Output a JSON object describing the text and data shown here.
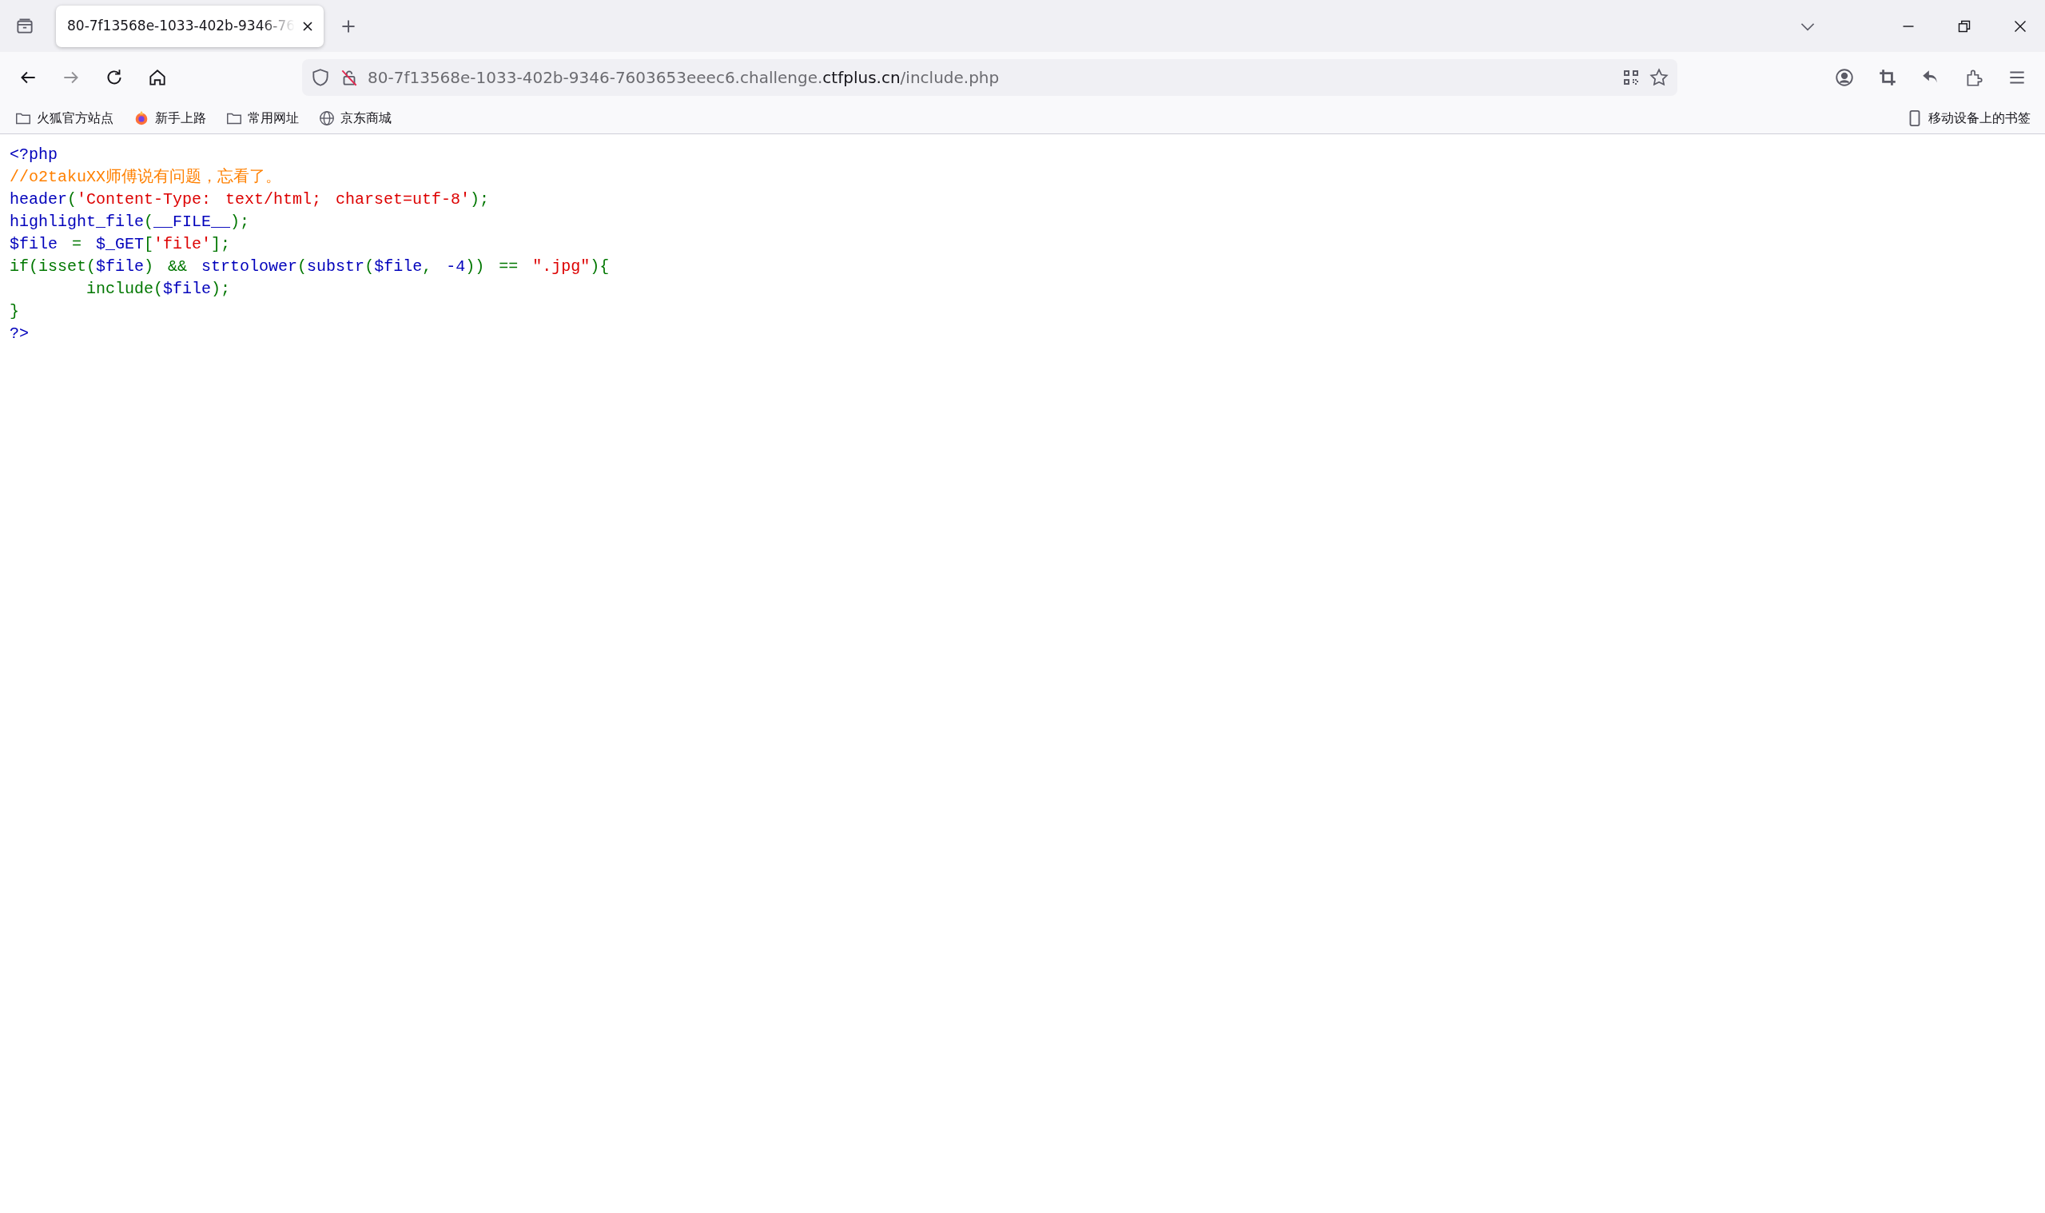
{
  "tabs": [
    {
      "title": "80-7f13568e-1033-402b-9346-76",
      "selected": true
    }
  ],
  "nav_buttons": [
    {
      "kind": "back",
      "disabled": false
    },
    {
      "kind": "forward",
      "disabled": true
    },
    {
      "kind": "reload",
      "disabled": false
    },
    {
      "kind": "home",
      "disabled": false
    }
  ],
  "address_bar": {
    "host_prefix": "80-7f13568e-1033-402b-9346-7603653eeec6.challenge.",
    "domain": "ctfplus.cn",
    "path": "/include.php"
  },
  "bookmarks": [
    {
      "kind": "folder",
      "label": "火狐官方站点"
    },
    {
      "kind": "firefox",
      "label": "新手上路"
    },
    {
      "kind": "folder",
      "label": "常用网址"
    },
    {
      "kind": "globe",
      "label": "京东商城"
    }
  ],
  "mobile_bookmarks": {
    "label": "移动设备上的书签"
  },
  "code_lines": [
    {
      "indented": false,
      "tokens": [
        {
          "kind": "default",
          "text": "<?php"
        }
      ]
    },
    {
      "indented": false,
      "tokens": [
        {
          "kind": "comment",
          "text": "//o2takuXX师傅说有问题，忘看了。"
        }
      ]
    },
    {
      "indented": false,
      "tokens": [
        {
          "kind": "default",
          "text": "header"
        },
        {
          "kind": "keyword",
          "text": "("
        },
        {
          "kind": "string",
          "text": "'Content-Type: text/html; charset=utf-8'"
        },
        {
          "kind": "keyword",
          "text": ");"
        }
      ]
    },
    {
      "indented": false,
      "tokens": [
        {
          "kind": "default",
          "text": "highlight_file"
        },
        {
          "kind": "keyword",
          "text": "("
        },
        {
          "kind": "default",
          "text": "__FILE__"
        },
        {
          "kind": "keyword",
          "text": ");"
        }
      ]
    },
    {
      "indented": false,
      "tokens": [
        {
          "kind": "default",
          "text": "$file"
        },
        {
          "kind": "keyword",
          "text": " = "
        },
        {
          "kind": "default",
          "text": "$_GET"
        },
        {
          "kind": "keyword",
          "text": "["
        },
        {
          "kind": "string",
          "text": "'file'"
        },
        {
          "kind": "keyword",
          "text": "];"
        }
      ]
    },
    {
      "indented": false,
      "tokens": [
        {
          "kind": "keyword",
          "text": "if(isset("
        },
        {
          "kind": "default",
          "text": "$file"
        },
        {
          "kind": "keyword",
          "text": ") && "
        },
        {
          "kind": "default",
          "text": "strtolower"
        },
        {
          "kind": "keyword",
          "text": "("
        },
        {
          "kind": "default",
          "text": "substr"
        },
        {
          "kind": "keyword",
          "text": "("
        },
        {
          "kind": "default",
          "text": "$file"
        },
        {
          "kind": "keyword",
          "text": ", "
        },
        {
          "kind": "default",
          "text": "-4"
        },
        {
          "kind": "keyword",
          "text": ")) == "
        },
        {
          "kind": "string",
          "text": "\".jpg\""
        },
        {
          "kind": "keyword",
          "text": "){"
        }
      ]
    },
    {
      "indented": true,
      "tokens": [
        {
          "kind": "keyword",
          "text": "include("
        },
        {
          "kind": "default",
          "text": "$file"
        },
        {
          "kind": "keyword",
          "text": ");"
        }
      ]
    },
    {
      "indented": false,
      "tokens": [
        {
          "kind": "keyword",
          "text": "}"
        }
      ]
    },
    {
      "indented": false,
      "tokens": [
        {
          "kind": "default",
          "text": "?>"
        }
      ]
    }
  ]
}
